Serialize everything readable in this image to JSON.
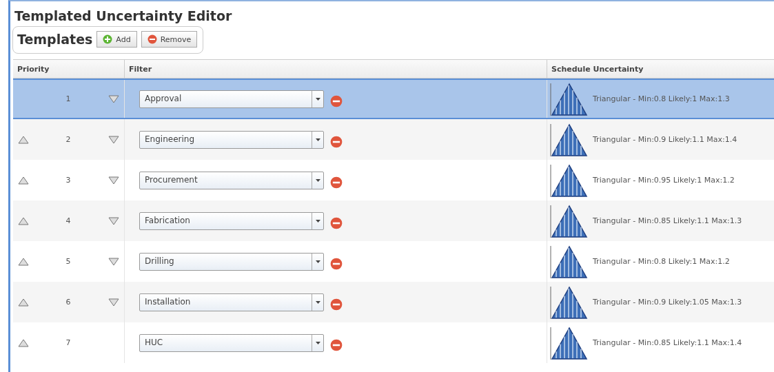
{
  "window": {
    "title": "Templated Uncertainty Editor"
  },
  "toolbar": {
    "title": "Templates",
    "buttons": [
      {
        "label": "Add",
        "kind": "add"
      },
      {
        "label": "Remove",
        "kind": "remove"
      }
    ]
  },
  "table": {
    "columns": [
      "Priority",
      "Filter",
      "Schedule Uncertainty"
    ],
    "rows": [
      {
        "priority": "1",
        "filter": "Approval",
        "uncertainty": "Triangular - Min:0.8 Likely:1 Max:1.3",
        "selected": true,
        "can_move_up": false,
        "can_move_down": true
      },
      {
        "priority": "2",
        "filter": "Engineering",
        "uncertainty": "Triangular - Min:0.9 Likely:1.1 Max:1.4",
        "selected": false,
        "can_move_up": true,
        "can_move_down": true
      },
      {
        "priority": "3",
        "filter": "Procurement",
        "uncertainty": "Triangular - Min:0.95 Likely:1 Max:1.2",
        "selected": false,
        "can_move_up": true,
        "can_move_down": true
      },
      {
        "priority": "4",
        "filter": "Fabrication",
        "uncertainty": "Triangular - Min:0.85 Likely:1.1 Max:1.3",
        "selected": false,
        "can_move_up": true,
        "can_move_down": true
      },
      {
        "priority": "5",
        "filter": "Drilling",
        "uncertainty": "Triangular - Min:0.8 Likely:1 Max:1.2",
        "selected": false,
        "can_move_up": true,
        "can_move_down": true
      },
      {
        "priority": "6",
        "filter": "Installation",
        "uncertainty": "Triangular - Min:0.9 Likely:1.05 Max:1.3",
        "selected": false,
        "can_move_up": true,
        "can_move_down": true
      },
      {
        "priority": "7",
        "filter": "HUC",
        "uncertainty": "Triangular - Min:0.85 Likely:1.1 Max:1.4",
        "selected": false,
        "can_move_up": true,
        "can_move_down": false
      }
    ]
  }
}
